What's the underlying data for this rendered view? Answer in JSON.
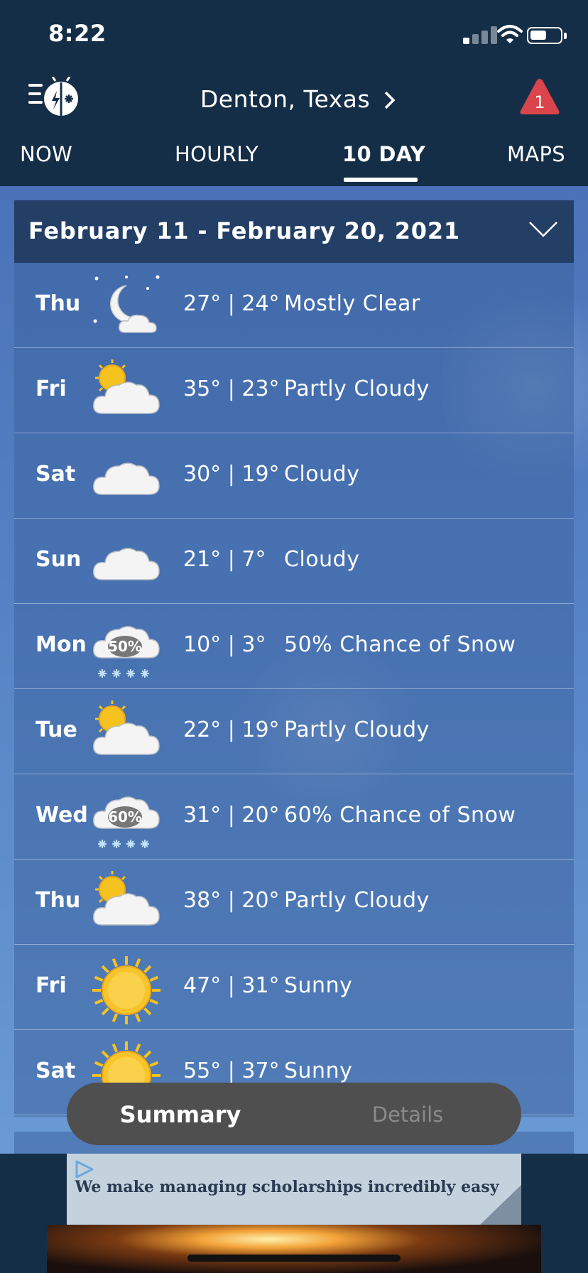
{
  "status_bar": {
    "time": "8:22"
  },
  "header": {
    "location": "Denton,  Texas",
    "alert_count": "1"
  },
  "tabs": [
    {
      "label": "NOW"
    },
    {
      "label": "HOURLY"
    },
    {
      "label": "10  DAY"
    },
    {
      "label": "MAPS"
    }
  ],
  "forecast": {
    "date_range": "February  11  -  February  20,  2021",
    "days": [
      {
        "day": "Thu",
        "temps": "27° | 24°",
        "desc": "Mostly  Clear",
        "icon": "moon-cloud-icon"
      },
      {
        "day": "Fri",
        "temps": "35° | 23°",
        "desc": "Partly  Cloudy",
        "icon": "partly-cloudy-icon"
      },
      {
        "day": "Sat",
        "temps": "30° | 19°",
        "desc": "Cloudy",
        "icon": "cloud-icon"
      },
      {
        "day": "Sun",
        "temps": "21° | 7°",
        "desc": "Cloudy",
        "icon": "cloud-icon"
      },
      {
        "day": "Mon",
        "temps": "10° | 3°",
        "desc": "50%  Chance  of  Snow",
        "icon": "snow-cloud-icon",
        "precip": "50%"
      },
      {
        "day": "Tue",
        "temps": "22° | 19°",
        "desc": "Partly  Cloudy",
        "icon": "partly-cloudy-icon"
      },
      {
        "day": "Wed",
        "temps": "31° | 20°",
        "desc": "60%  Chance  of  Snow",
        "icon": "snow-cloud-icon",
        "precip": "60%"
      },
      {
        "day": "Thu",
        "temps": "38° | 20°",
        "desc": "Partly  Cloudy",
        "icon": "partly-cloudy-icon"
      },
      {
        "day": "Fri",
        "temps": "47° | 31°",
        "desc": "Sunny",
        "icon": "sun-icon"
      },
      {
        "day": "Sat",
        "temps": "55° | 37°",
        "desc": "Sunny",
        "icon": "sun-icon"
      }
    ]
  },
  "toggle": {
    "summary": "Summary",
    "details": "Details"
  },
  "ad": {
    "text": "We make managing scholarships incredibly easy"
  }
}
